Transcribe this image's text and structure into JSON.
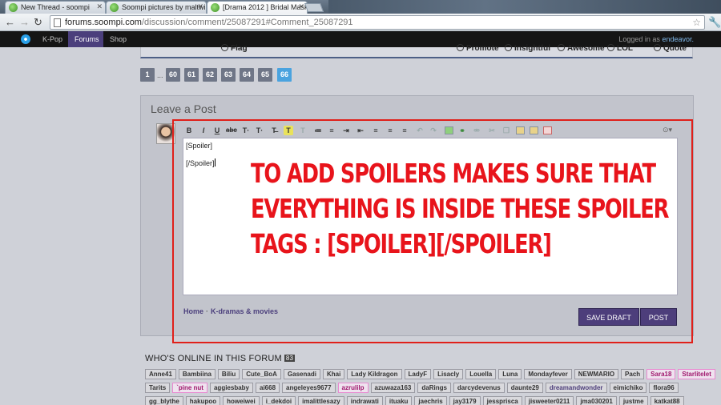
{
  "browser": {
    "tabs": [
      {
        "title": "New Thread - soompi",
        "active": false
      },
      {
        "title": "Soompi pictures by maltwi",
        "active": false
      },
      {
        "title": "[Drama 2012 ] Bridal Mask",
        "active": true
      }
    ],
    "url_domain": "forums.soompi.com",
    "url_path": "/discussion/comment/25087291#Comment_25087291"
  },
  "site_nav": {
    "items": [
      "K-Pop",
      "Forums",
      "Shop"
    ],
    "active": "Forums",
    "logged_in_prefix": "Logged in as",
    "username": "endeavor."
  },
  "previous_post_actions": [
    "Flag",
    "Promote",
    "Insightful",
    "Awesome",
    "LOL",
    "Quote"
  ],
  "pagination": {
    "first": "1",
    "ellipsis": "...",
    "pages": [
      "60",
      "61",
      "62",
      "63",
      "64",
      "65",
      "66"
    ],
    "current": "66"
  },
  "leave_post": {
    "title": "Leave a Post",
    "editor_lines": [
      "[Spoiler]",
      "[/Spoiler]"
    ],
    "annotation": "To add spoilers makes sure that everything is inside these spoiler tags : [spoiler][/spoiler]",
    "breadcrumbs": [
      "Home",
      "K-dramas & movies"
    ],
    "save_draft_label": "Save Draft",
    "post_label": "Post"
  },
  "toolbar_icons": [
    "bold",
    "italic",
    "underline",
    "strikethrough",
    "font-size",
    "font-color",
    "clear-format",
    "highlight",
    "remove-format",
    "bullet-list",
    "numbered-list",
    "indent",
    "outdent",
    "align-left",
    "align-center",
    "align-right",
    "undo",
    "redo",
    "image",
    "link",
    "unlink",
    "cut",
    "copy",
    "paste",
    "paste-word",
    "source"
  ],
  "online": {
    "title": "WHO'S ONLINE IN THIS FORUM",
    "count": "83",
    "users": [
      "Anne41",
      "Bambiina",
      "Biliu",
      "Cute_BoA",
      "Gasenadi",
      "Khai",
      "Lady Kildragon",
      "LadyF",
      "Lisacly",
      "Louella",
      "Luna",
      "Mondayfever",
      "NEWMARIO",
      "Pach",
      "Sara18",
      "Starlitelet",
      "Tarits",
      "`pine nut",
      "aggiesbaby",
      "ai668",
      "angeleyes9677",
      "azrulilp",
      "azuwaza163",
      "daRings",
      "darcydevenus",
      "daunte29",
      "dreamandwonder",
      "eimichiko",
      "flora96",
      "gg_blythe",
      "hakupoo",
      "howeiwei",
      "i_dekdoi",
      "imalittlesazy",
      "indrawati",
      "ituaku",
      "jaechris",
      "jay3179",
      "jessprisca",
      "jisweeter0211",
      "jma030201",
      "justme",
      "katkat88"
    ]
  },
  "colors": {
    "accent": "#4d3e7b",
    "annotation_red": "#e8141b",
    "current_page": "#4aa3df"
  }
}
